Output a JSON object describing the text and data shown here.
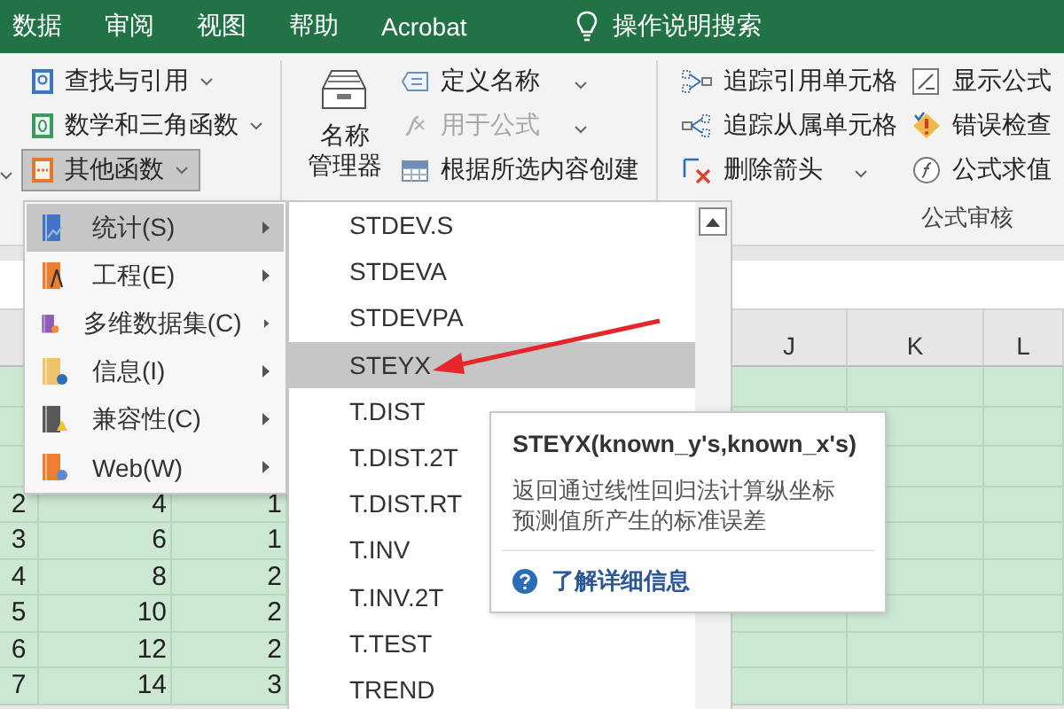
{
  "ribbon_tabs": [
    {
      "label": "数据"
    },
    {
      "label": "审阅"
    },
    {
      "label": "视图"
    },
    {
      "label": "帮助"
    },
    {
      "label": "Acrobat"
    }
  ],
  "tell_me": {
    "label": "操作说明搜索"
  },
  "function_library": {
    "items": [
      {
        "label": "查找与引用",
        "kind": "lookup",
        "pressed": false
      },
      {
        "label": "数学和三角函数",
        "kind": "math",
        "pressed": false
      },
      {
        "label": "其他函数",
        "kind": "more",
        "pressed": true
      }
    ]
  },
  "defined_names": {
    "manager": {
      "lines": [
        "名称",
        "管理器"
      ]
    },
    "items": [
      {
        "label": "定义名称",
        "kind": "define",
        "dropdown": true,
        "disabled": false
      },
      {
        "label": "用于公式",
        "kind": "use",
        "dropdown": true,
        "disabled": true
      },
      {
        "label": "根据所选内容创建",
        "kind": "create",
        "dropdown": false,
        "disabled": false
      }
    ]
  },
  "formula_auditing": {
    "title": "公式审核",
    "items": [
      {
        "label": "追踪引用单元格",
        "kind": "precedents",
        "dropdown": false
      },
      {
        "label": "显示公式",
        "kind": "show",
        "dropdown": false
      },
      {
        "label": "追踪从属单元格",
        "kind": "dependents",
        "dropdown": false
      },
      {
        "label": "错误检查",
        "kind": "error",
        "dropdown": false
      },
      {
        "label": "删除箭头",
        "kind": "remove",
        "dropdown": true
      },
      {
        "label": "公式求值",
        "kind": "evaluate",
        "dropdown": false
      }
    ]
  },
  "sheet": {
    "columns": [
      "J",
      "K",
      "L"
    ],
    "rows": [
      {
        "number": "2",
        "cells": [
          "4",
          "1"
        ]
      },
      {
        "number": "3",
        "cells": [
          "6",
          "1"
        ]
      },
      {
        "number": "4",
        "cells": [
          "8",
          "2"
        ]
      },
      {
        "number": "5",
        "cells": [
          "10",
          "2"
        ]
      },
      {
        "number": "6",
        "cells": [
          "12",
          "2"
        ]
      },
      {
        "number": "7",
        "cells": [
          "14",
          "3"
        ]
      }
    ]
  },
  "more_functions_menu": {
    "items": [
      {
        "label": "统计(S)",
        "kind": "stats",
        "selected": true
      },
      {
        "label": "工程(E)",
        "kind": "engineering",
        "selected": false
      },
      {
        "label": "多维数据集(C)",
        "kind": "cube",
        "selected": false
      },
      {
        "label": "信息(I)",
        "kind": "info",
        "selected": false
      },
      {
        "label": "兼容性(C)",
        "kind": "compat",
        "selected": false
      },
      {
        "label": "Web(W)",
        "kind": "web",
        "selected": false
      }
    ]
  },
  "statistical_submenu": {
    "items": [
      {
        "label": "STDEV.S",
        "selected": false
      },
      {
        "label": "STDEVA",
        "selected": false
      },
      {
        "label": "STDEVPA",
        "selected": false
      },
      {
        "label": "STEYX",
        "selected": true
      },
      {
        "label": "T.DIST",
        "selected": false
      },
      {
        "label": "T.DIST.2T",
        "selected": false
      },
      {
        "label": "T.DIST.RT",
        "selected": false
      },
      {
        "label": "T.INV",
        "selected": false
      },
      {
        "label": "T.INV.2T",
        "selected": false
      },
      {
        "label": "T.TEST",
        "selected": false
      },
      {
        "label": "TREND",
        "selected": false
      }
    ]
  },
  "tooltip": {
    "title": "STEYX(known_y's,known_x's)",
    "description": "返回通过线性回归法计算纵坐标预测值所产生的标准误差",
    "link": "了解详细信息"
  }
}
